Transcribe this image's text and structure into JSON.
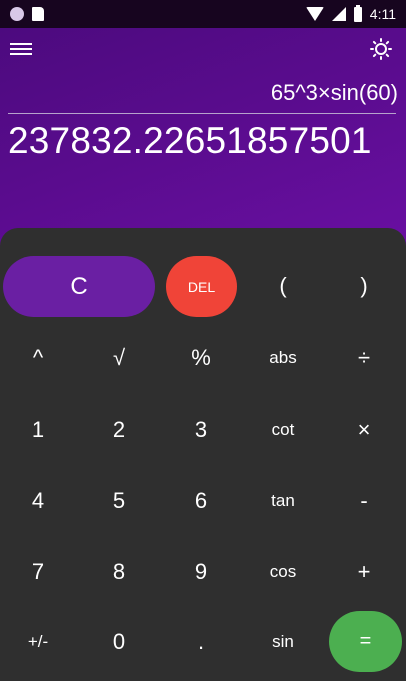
{
  "statusbar": {
    "time": "4:11"
  },
  "display": {
    "expression": "65^3×sin(60)",
    "result": "237832.22651857501"
  },
  "keypad": {
    "clear": "C",
    "del": "DEL",
    "lparen": "(",
    "rparen": ")",
    "pow": "^",
    "sqrt": "√",
    "percent": "%",
    "abs": "abs",
    "divide": "÷",
    "n1": "1",
    "n2": "2",
    "n3": "3",
    "cot": "cot",
    "multiply": "×",
    "n4": "4",
    "n5": "5",
    "n6": "6",
    "tan": "tan",
    "minus": "-",
    "n7": "7",
    "n8": "8",
    "n9": "9",
    "cos": "cos",
    "plus": "+",
    "sign": "+/-",
    "n0": "0",
    "dot": ".",
    "sin": "sin",
    "equals": "="
  }
}
